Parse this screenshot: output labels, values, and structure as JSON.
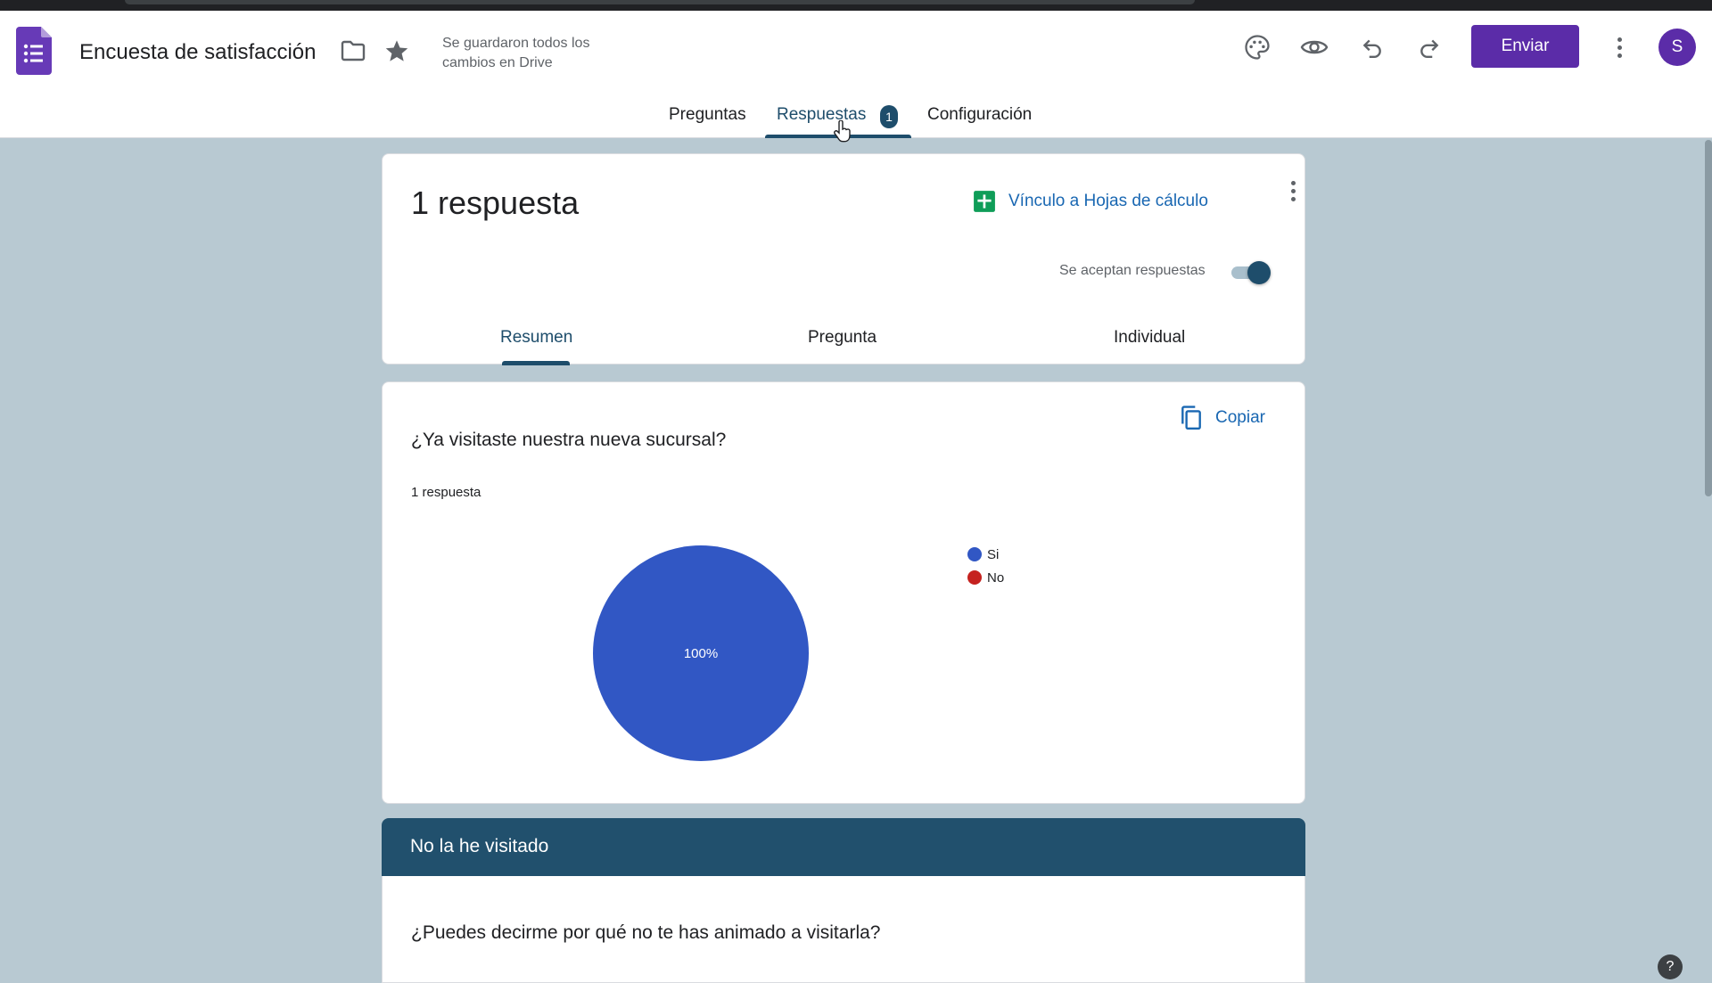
{
  "app": {
    "title": "Encuesta de satisfacción",
    "save_status": "Se guardaron todos los cambios en Drive",
    "send_label": "Enviar",
    "avatar_initial": "S",
    "brand_color": "#5b2ca8",
    "accent_color": "#1e4d6b"
  },
  "nav": {
    "tabs": [
      {
        "label": "Preguntas"
      },
      {
        "label": "Respuestas"
      },
      {
        "label": "Configuración"
      }
    ],
    "responses_badge": "1",
    "active": "Respuestas"
  },
  "summary": {
    "count_label": "1 respuesta",
    "sheets_link": "Vínculo a Hojas de cálculo",
    "accepting_label": "Se aceptan respuestas",
    "accepting": true,
    "subtabs": [
      {
        "label": "Resumen"
      },
      {
        "label": "Pregunta"
      },
      {
        "label": "Individual"
      }
    ]
  },
  "question1": {
    "title": "¿Ya visitaste nuestra nueva sucursal?",
    "responses_label": "1 respuesta",
    "copy_label": "Copiar"
  },
  "chart_data": {
    "type": "pie",
    "categories": [
      "Si",
      "No"
    ],
    "values": [
      1,
      0
    ],
    "colors": [
      "#3157c4",
      "#c5221f"
    ],
    "slice_label": "100%",
    "legend_position": "right"
  },
  "section": {
    "title": "No la he visitado",
    "question": "¿Puedes decirme por qué no te has animado a visitarla?"
  },
  "help_label": "?"
}
